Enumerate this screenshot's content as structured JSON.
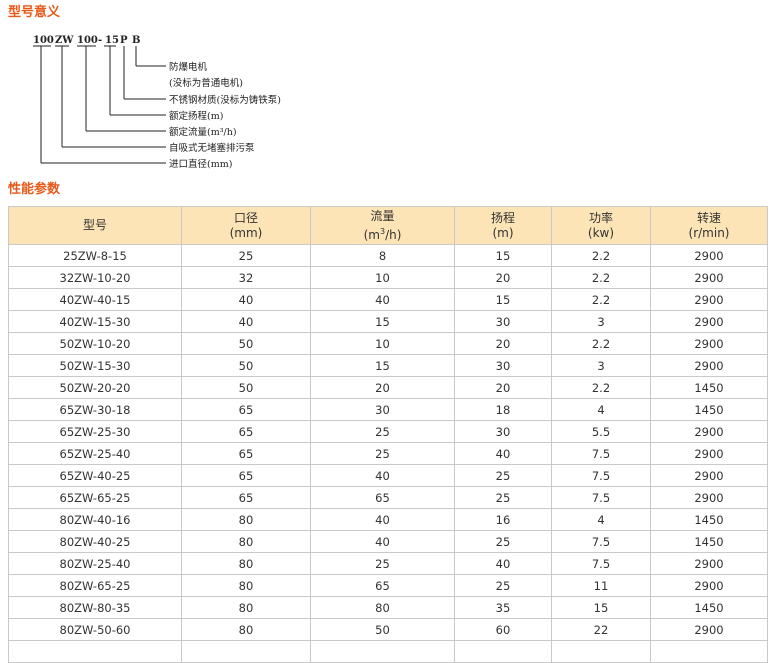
{
  "model_section": {
    "title": "型号意义",
    "code_parts": [
      "100",
      "ZW",
      "100",
      "-",
      "15",
      "P",
      "B"
    ],
    "explanations": [
      "防爆电机",
      "(没标为普通电机)",
      "不锈钢材质(没标为铸铁泵)",
      "额定扬程(m)",
      "额定流量(m³/h)",
      "自吸式无堵塞排污泵",
      "进口直径(mm)"
    ]
  },
  "perf_section": {
    "title": "性能参数",
    "headers": [
      {
        "label": "型号",
        "unit": ""
      },
      {
        "label": "口径",
        "unit": "(mm)"
      },
      {
        "label": "流量",
        "unit_pre": "(m",
        "unit_sup": "3",
        "unit_post": "/h)"
      },
      {
        "label": "扬程",
        "unit": "(m)"
      },
      {
        "label": "功率",
        "unit": "(kw)"
      },
      {
        "label": "转速",
        "unit": "(r/min)"
      }
    ],
    "rows": [
      [
        "25ZW-8-15",
        "25",
        "8",
        "15",
        "2.2",
        "2900"
      ],
      [
        "32ZW-10-20",
        "32",
        "10",
        "20",
        "2.2",
        "2900"
      ],
      [
        "40ZW-40-15",
        "40",
        "40",
        "15",
        "2.2",
        "2900"
      ],
      [
        "40ZW-15-30",
        "40",
        "15",
        "30",
        "3",
        "2900"
      ],
      [
        "50ZW-10-20",
        "50",
        "10",
        "20",
        "2.2",
        "2900"
      ],
      [
        "50ZW-15-30",
        "50",
        "15",
        "30",
        "3",
        "2900"
      ],
      [
        "50ZW-20-20",
        "50",
        "20",
        "20",
        "2.2",
        "1450"
      ],
      [
        "65ZW-30-18",
        "65",
        "30",
        "18",
        "4",
        "1450"
      ],
      [
        "65ZW-25-30",
        "65",
        "25",
        "30",
        "5.5",
        "2900"
      ],
      [
        "65ZW-25-40",
        "65",
        "25",
        "40",
        "7.5",
        "2900"
      ],
      [
        "65ZW-40-25",
        "65",
        "40",
        "25",
        "7.5",
        "2900"
      ],
      [
        "65ZW-65-25",
        "65",
        "65",
        "25",
        "7.5",
        "2900"
      ],
      [
        "80ZW-40-16",
        "80",
        "40",
        "16",
        "4",
        "1450"
      ],
      [
        "80ZW-40-25",
        "80",
        "40",
        "25",
        "7.5",
        "1450"
      ],
      [
        "80ZW-25-40",
        "80",
        "25",
        "40",
        "7.5",
        "2900"
      ],
      [
        "80ZW-65-25",
        "80",
        "65",
        "25",
        "11",
        "2900"
      ],
      [
        "80ZW-80-35",
        "80",
        "80",
        "35",
        "15",
        "1450"
      ],
      [
        "80ZW-50-60",
        "80",
        "50",
        "60",
        "22",
        "2900"
      ]
    ]
  }
}
